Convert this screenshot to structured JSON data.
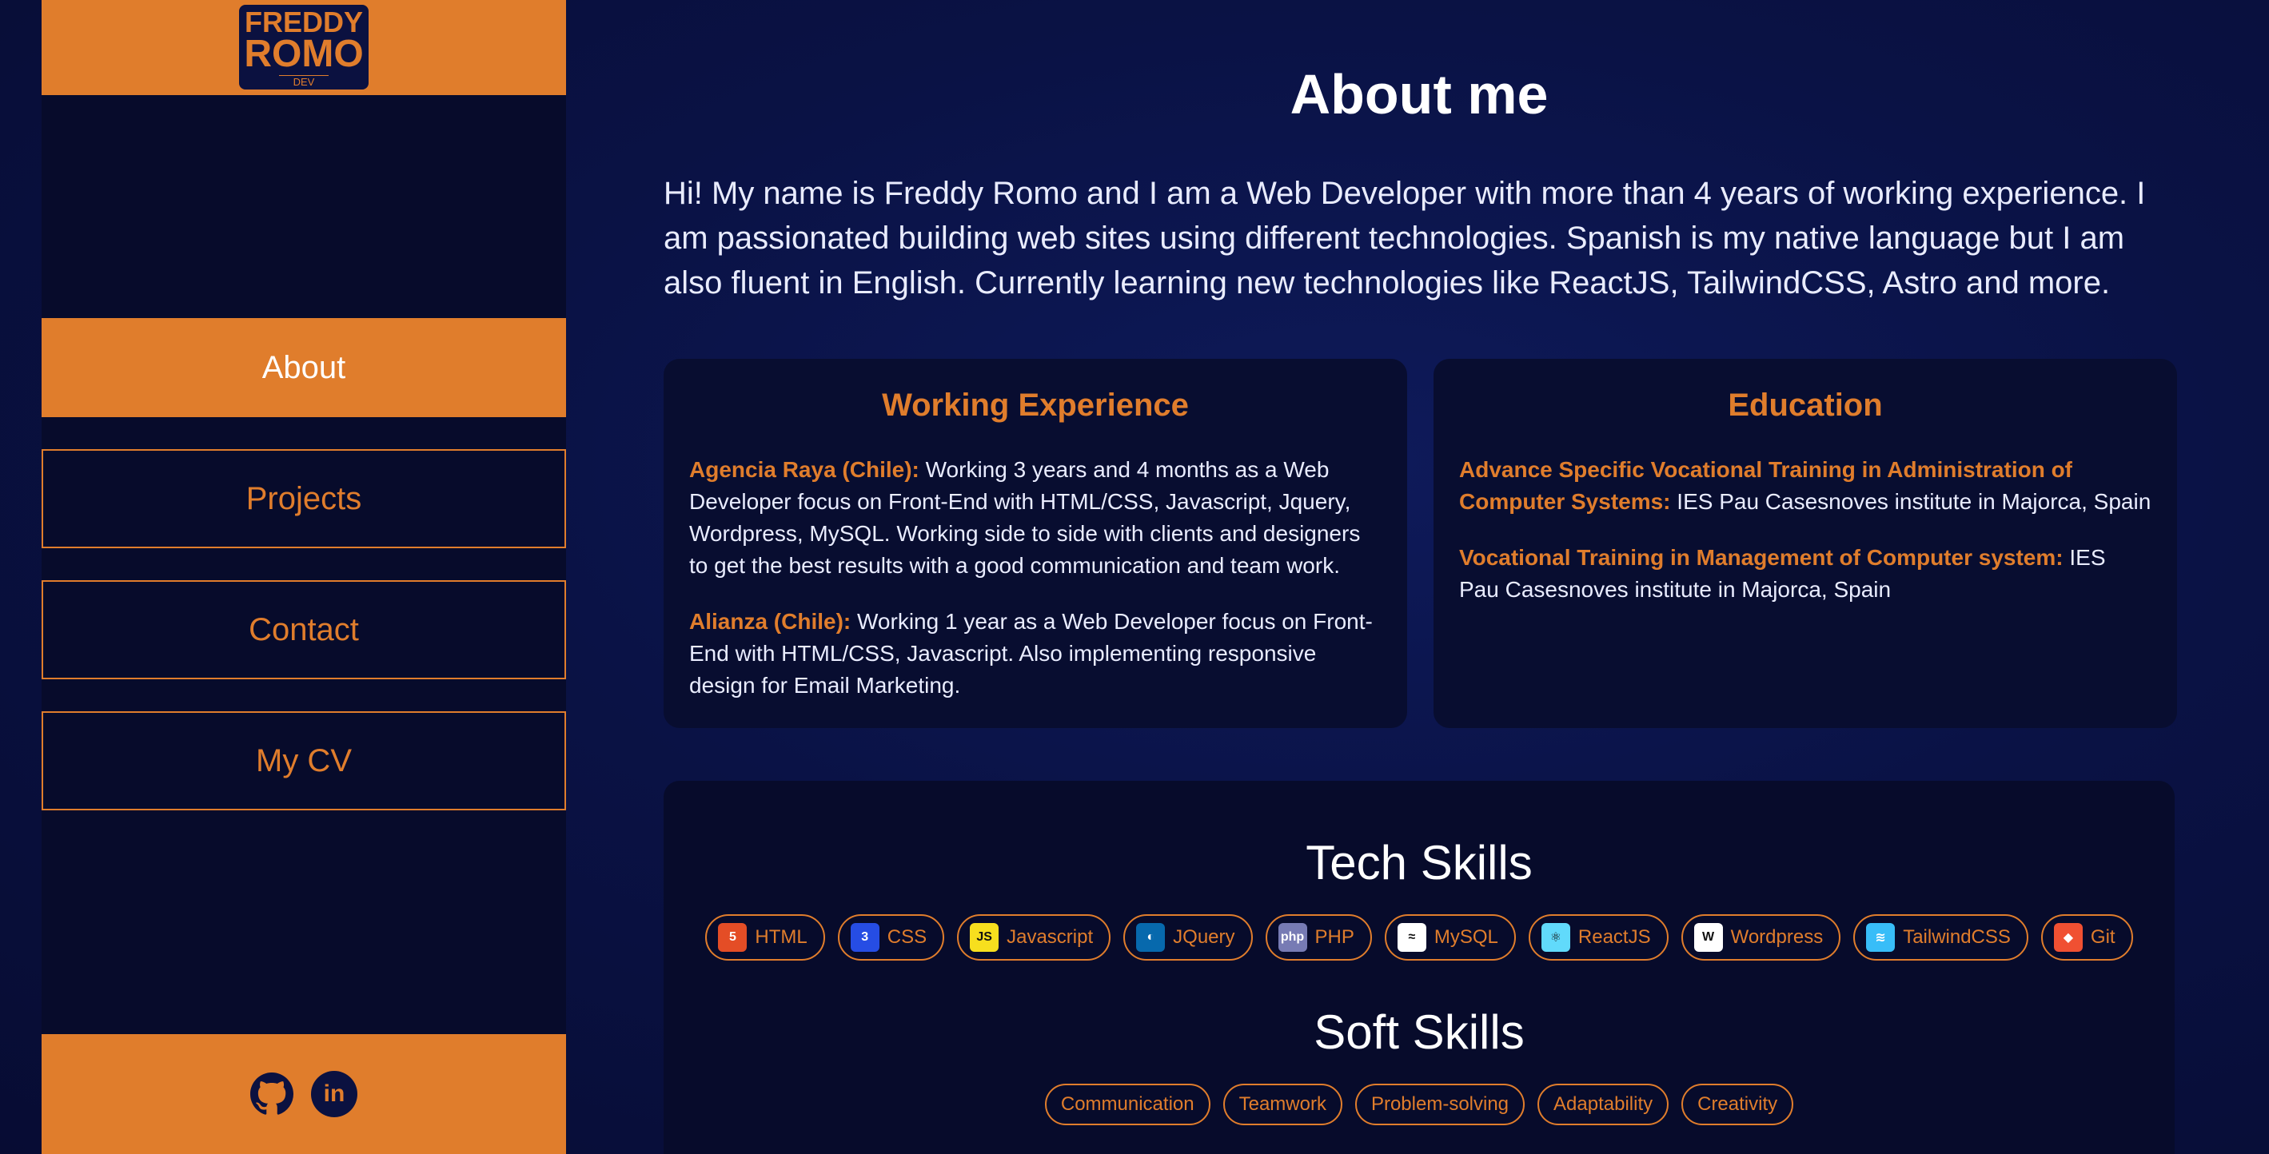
{
  "logo": {
    "line1": "FREDDY",
    "line2": "ROMO",
    "line3": "DEV"
  },
  "nav": [
    {
      "label": "About"
    },
    {
      "label": "Projects"
    },
    {
      "label": "Contact"
    },
    {
      "label": "My CV"
    }
  ],
  "social": [
    "github-icon",
    "linkedin-icon"
  ],
  "about": {
    "title": "About me",
    "intro": "Hi! My name is Freddy Romo and I am a Web Developer with more than 4 years of working experience. I am passionated building web sites using different technologies. Spanish is my native language but I am also fluent in English. Currently learning new technologies like ReactJS, TailwindCSS, Astro and more."
  },
  "experience": {
    "title": "Working Experience",
    "items": [
      {
        "company": "Agencia Raya (Chile):",
        "text": " Working 3 years and 4 months as a Web Developer focus on Front-End with HTML/CSS, Javascript, Jquery, Wordpress, MySQL. Working side to side with clients and designers to get the best results with a good communication and team work."
      },
      {
        "company": "Alianza (Chile):",
        "text": " Working 1 year as a Web Developer focus on Front-End with HTML/CSS, Javascript. Also implementing responsive design for Email Marketing."
      }
    ]
  },
  "education": {
    "title": "Education",
    "items": [
      {
        "degree": "Advance Specific Vocational Training in Administration of Computer Systems:",
        "text": " IES Pau Casesnoves institute in Majorca, Spain"
      },
      {
        "degree": "Vocational Training in Management of Computer system:",
        "text": " IES Pau Casesnoves institute in Majorca, Spain"
      }
    ]
  },
  "tech_skills": {
    "title": "Tech Skills",
    "items": [
      {
        "label": "HTML",
        "icon": "html5-icon",
        "glyph": "5",
        "color": "#e44d26"
      },
      {
        "label": "CSS",
        "icon": "css3-icon",
        "glyph": "3",
        "color": "#264de4"
      },
      {
        "label": "Javascript",
        "icon": "javascript-icon",
        "glyph": "JS",
        "color": "#f7df1e"
      },
      {
        "label": "JQuery",
        "icon": "jquery-icon",
        "glyph": "◐",
        "color": "#0769ad"
      },
      {
        "label": "PHP",
        "icon": "php-icon",
        "glyph": "php",
        "color": "#777bb4"
      },
      {
        "label": "MySQL",
        "icon": "mysql-icon",
        "glyph": "≈",
        "color": "#ffffff"
      },
      {
        "label": "ReactJS",
        "icon": "react-icon",
        "glyph": "⚛",
        "color": "#61dafb"
      },
      {
        "label": "Wordpress",
        "icon": "wordpress-icon",
        "glyph": "W",
        "color": "#ffffff"
      },
      {
        "label": "TailwindCSS",
        "icon": "tailwind-icon",
        "glyph": "≋",
        "color": "#38bdf8"
      },
      {
        "label": "Git",
        "icon": "git-icon",
        "glyph": "◆",
        "color": "#f05032"
      }
    ]
  },
  "soft_skills": {
    "title": "Soft Skills",
    "items": [
      "Communication",
      "Teamwork",
      "Problem-solving",
      "Adaptability",
      "Creativity"
    ]
  }
}
